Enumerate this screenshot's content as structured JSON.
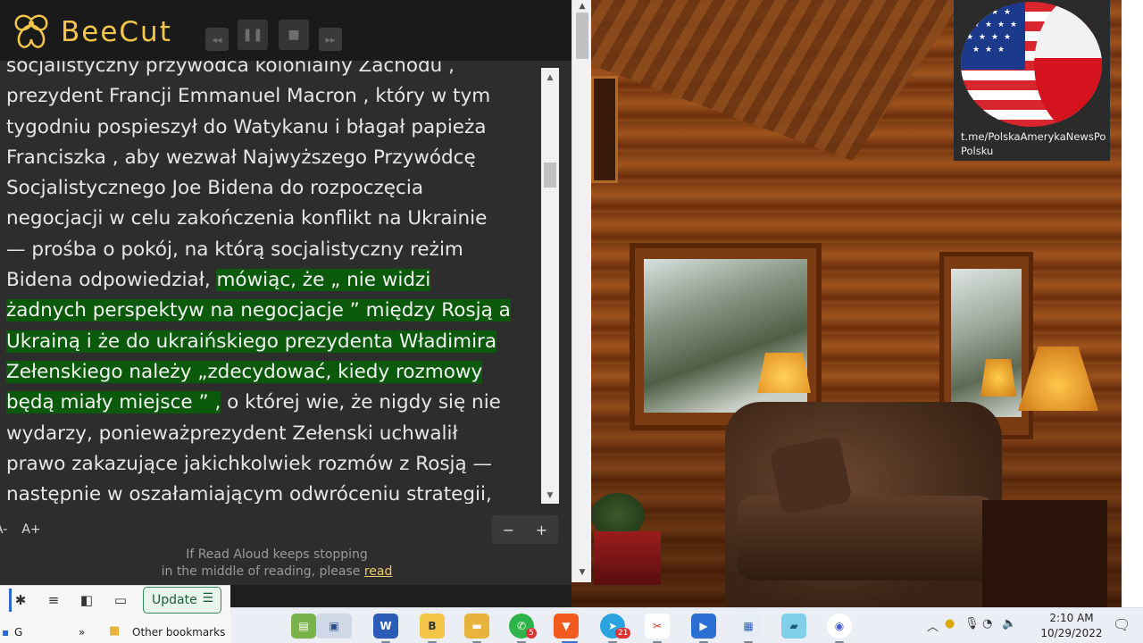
{
  "app": {
    "logo_text": "BeeCut"
  },
  "badge": {
    "channel_text": "t.me/PolskaAmerykaNewsPoPolsku"
  },
  "reader": {
    "lines": [
      {
        "pre": "socjalistyczny przywódca kolonialny Zachodu ,",
        "hl": "",
        "post": ""
      },
      {
        "pre": "prezydent Francji Emmanuel Macron , który w tym",
        "hl": "",
        "post": ""
      },
      {
        "pre": "tygodniu pospieszył do Watykanu i błagał papieża",
        "hl": "",
        "post": ""
      },
      {
        "pre": "Franciszka , aby wezwał Najwyższego Przywódcę",
        "hl": "",
        "post": ""
      },
      {
        "pre": "Socjalistycznego Joe Bidena do rozpoczęcia",
        "hl": "",
        "post": ""
      },
      {
        "pre": "negocjacji w celu zakończenia konflikt na Ukrainie",
        "hl": "",
        "post": ""
      },
      {
        "pre": "— prośba o pokój, na którą socjalistyczny reżim",
        "hl": "",
        "post": ""
      },
      {
        "pre": "Bidena odpowiedział, ",
        "hl": "mówiąc, że „ nie widzi",
        "post": ""
      },
      {
        "pre": "",
        "hl": "żadnych perspektyw na negocjacje ” między Rosją a",
        "post": ""
      },
      {
        "pre": "",
        "hl": "Ukrainą i że do ukraińskiego prezydenta Władimira",
        "post": ""
      },
      {
        "pre": "",
        "hl": "Zełenskiego należy „zdecydować, kiedy rozmowy",
        "post": ""
      },
      {
        "pre": "",
        "hl": "będą miały miejsce ” ,",
        "post": " o której wie, że nigdy się nie"
      },
      {
        "pre": "wydarzy, ponieważprezydent Zełenski uchwalił",
        "hl": "",
        "post": ""
      },
      {
        "pre": "prawo zakazujące jakichkolwiek rozmów z Rosją —",
        "hl": "",
        "post": ""
      },
      {
        "pre": "następnie w oszałamiającym odwróceniu strategii,",
        "hl": "",
        "post": ""
      }
    ],
    "font_decrease": "A-",
    "font_increase": "A+",
    "zoom_minus": "−",
    "zoom_plus": "+",
    "hint_line1": "If Read Aloud keeps stopping",
    "hint_line2": "in the middle of reading, please",
    "hint_link": "read"
  },
  "browser": {
    "update_label": "Update",
    "bookmark_g": "G",
    "bookmark_more": "»",
    "other_bookmarks": "Other bookmarks"
  },
  "taskbar": {
    "time": "2:10 AM",
    "date": "10/29/2022",
    "whatsapp_badge": "5",
    "telegram_badge": "21"
  }
}
